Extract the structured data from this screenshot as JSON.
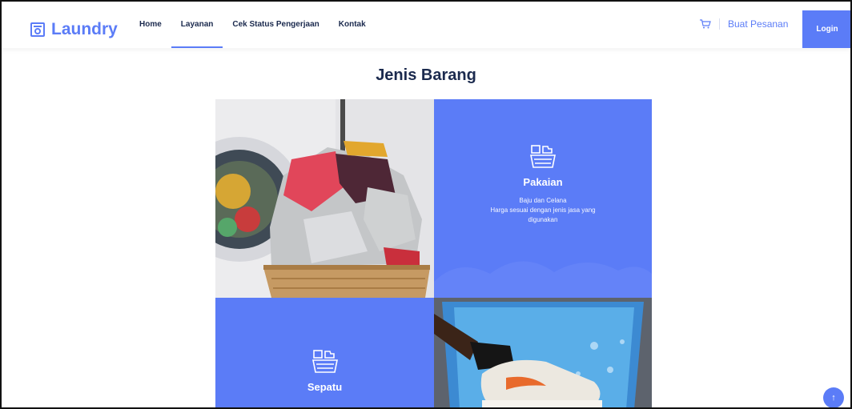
{
  "nav": {
    "brand": "Laundry",
    "items": [
      {
        "label": "Home"
      },
      {
        "label": "Layanan",
        "active": true
      },
      {
        "label": "Cek Status Pengerjaan"
      },
      {
        "label": "Kontak"
      }
    ],
    "order_label": "Buat Pesanan",
    "login_label": "Login"
  },
  "section": {
    "title": "Jenis Barang"
  },
  "cards": [
    {
      "title": "Pakaian",
      "desc_line1": "Baju dan Celana",
      "desc_line2": "Harga sesuai dengan jenis jasa yang",
      "desc_line3": "digunakan",
      "icon": "laundry-basket-icon"
    },
    {
      "title": "Sepatu",
      "icon": "laundry-basket-icon"
    }
  ],
  "colors": {
    "accent": "#5b7cf7",
    "text": "#1b2a4e"
  }
}
